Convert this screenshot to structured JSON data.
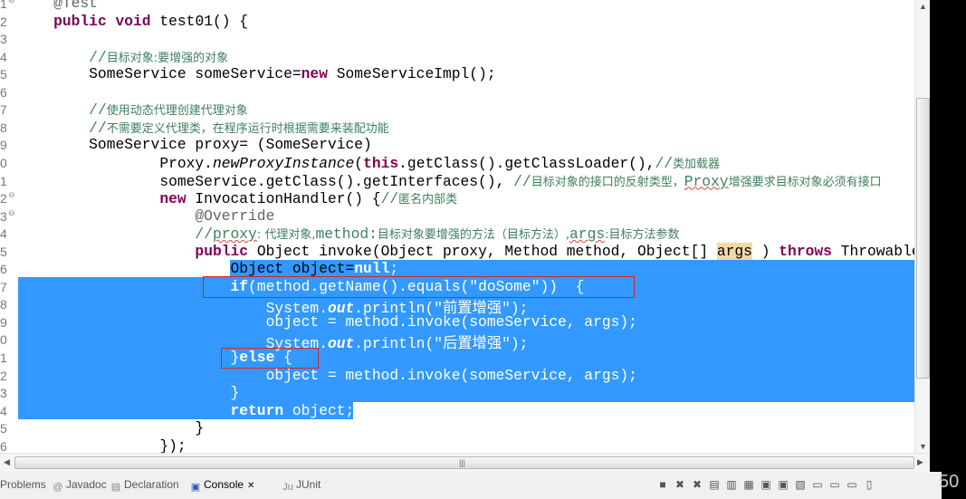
{
  "editor": {
    "lines": [
      {
        "num": "1",
        "fold": true,
        "segs": [
          [
            "an",
            "    @Test"
          ]
        ]
      },
      {
        "num": "2",
        "segs": [
          [
            "",
            "    "
          ],
          [
            "kw",
            "public"
          ],
          [
            "",
            " "
          ],
          [
            "kw",
            "void"
          ],
          [
            "",
            " test01() {"
          ]
        ]
      },
      {
        "num": "3",
        "segs": []
      },
      {
        "num": "4",
        "segs": [
          [
            "",
            "        "
          ],
          [
            "cm",
            "//"
          ],
          [
            "cmz",
            "目标对象:要增强的对象"
          ]
        ]
      },
      {
        "num": "5",
        "segs": [
          [
            "",
            "        SomeService someService="
          ],
          [
            "kw",
            "new"
          ],
          [
            "",
            " SomeServiceImpl();"
          ]
        ]
      },
      {
        "num": "6",
        "segs": []
      },
      {
        "num": "7",
        "segs": [
          [
            "",
            "        "
          ],
          [
            "cm",
            "//"
          ],
          [
            "cmz",
            "使用动态代理创建代理对象"
          ]
        ]
      },
      {
        "num": "8",
        "segs": [
          [
            "",
            "        "
          ],
          [
            "cm",
            "//"
          ],
          [
            "cmz",
            "不需要定义代理类，在程序运行时根据需要来装配功能"
          ]
        ]
      },
      {
        "num": "9",
        "segs": [
          [
            "",
            "        SomeService proxy= (SomeService)"
          ]
        ]
      },
      {
        "num": "0",
        "segs": [
          [
            "",
            "                Proxy."
          ],
          [
            "it",
            "newProxyInstance"
          ],
          [
            "",
            "("
          ],
          [
            "kw",
            "this"
          ],
          [
            "",
            ".getClass().getClassLoader(),"
          ],
          [
            "cm",
            "//"
          ],
          [
            "cmz",
            "类加载器"
          ]
        ]
      },
      {
        "num": "1",
        "segs": [
          [
            "",
            "                someService.getClass().getInterfaces(), "
          ],
          [
            "cm",
            "//"
          ],
          [
            "cmz",
            "目标对象的接口的反射类型，"
          ],
          [
            "cm sq",
            "Proxy"
          ],
          [
            "cmz",
            "增强要求目标对象必须有接口"
          ]
        ]
      },
      {
        "num": "2",
        "fold": true,
        "segs": [
          [
            "",
            "                "
          ],
          [
            "kw",
            "new"
          ],
          [
            "",
            " InvocationHandler() {"
          ],
          [
            "cm",
            "//"
          ],
          [
            "cmz",
            "匿名内部类"
          ]
        ]
      },
      {
        "num": "3",
        "fold": true,
        "segs": [
          [
            "an",
            "                    @Override"
          ]
        ]
      },
      {
        "num": "4",
        "segs": [
          [
            "",
            "                    "
          ],
          [
            "cm",
            "//"
          ],
          [
            "cm sq",
            "proxy"
          ],
          [
            "cmz",
            ": 代理对象,"
          ],
          [
            "cm",
            "method:"
          ],
          [
            "cmz",
            "目标对象要增强的方法（目标方法）,"
          ],
          [
            "cm sq",
            "args"
          ],
          [
            "cmz",
            ":目标方法参数"
          ]
        ]
      },
      {
        "num": "5",
        "segs": [
          [
            "",
            "                    "
          ],
          [
            "kw",
            "public"
          ],
          [
            "",
            " Object invoke(Object proxy, Method method, Object[] "
          ],
          [
            "occ",
            "args"
          ],
          [
            "",
            " ) "
          ],
          [
            "kw",
            "throws"
          ],
          [
            "",
            " Throwable {"
          ]
        ]
      },
      {
        "num": "6",
        "segs": [
          [
            "",
            "                        Object object="
          ],
          [
            "kw",
            "null"
          ],
          [
            "",
            ";"
          ]
        ]
      },
      {
        "num": "7",
        "segs": [
          [
            "",
            "                        "
          ],
          [
            "kw",
            "if"
          ],
          [
            "",
            "(method.getName().equals("
          ],
          [
            "st",
            "\"doSome\""
          ],
          [
            "",
            "))  {"
          ]
        ]
      },
      {
        "num": "8",
        "segs": [
          [
            "",
            "                            System."
          ],
          [
            "fd",
            "out"
          ],
          [
            "",
            ".println("
          ],
          [
            "st",
            "\"前置增强\""
          ],
          [
            "",
            ");"
          ]
        ]
      },
      {
        "num": "9",
        "segs": [
          [
            "",
            "                            object = method.invoke(someService, args);"
          ]
        ]
      },
      {
        "num": "0",
        "segs": [
          [
            "",
            "                            System."
          ],
          [
            "fd",
            "out"
          ],
          [
            "",
            ".println("
          ],
          [
            "st",
            "\"后置增强\""
          ],
          [
            "",
            ");"
          ]
        ]
      },
      {
        "num": "1",
        "segs": [
          [
            "",
            "                        }"
          ],
          [
            "kw",
            "else"
          ],
          [
            "",
            " {"
          ]
        ]
      },
      {
        "num": "2",
        "segs": [
          [
            "",
            "                            object = method.invoke(someService, args);"
          ]
        ]
      },
      {
        "num": "3",
        "segs": [
          [
            "",
            "                        }"
          ]
        ]
      },
      {
        "num": "4",
        "segs": [
          [
            "",
            "                        "
          ],
          [
            "kw",
            "return"
          ],
          [
            "",
            " object;"
          ]
        ]
      },
      {
        "num": "5",
        "segs": [
          [
            "",
            "                    }"
          ]
        ]
      },
      {
        "num": "6",
        "segs": [
          [
            "",
            "                });"
          ]
        ]
      }
    ]
  },
  "panel": {
    "tabs": [
      {
        "label": "Problems",
        "icon": "problems-icon"
      },
      {
        "label": "Javadoc",
        "icon": "javadoc-icon",
        "glyph": "@"
      },
      {
        "label": "Declaration",
        "icon": "declaration-icon",
        "glyph": "▤"
      },
      {
        "label": "Console",
        "icon": "console-icon",
        "glyph": "▣",
        "active": true,
        "close": "✕"
      },
      {
        "label": "JUnit",
        "icon": "junit-icon",
        "glyph": "Ju"
      }
    ],
    "toolbar_icons": [
      "terminate-icon",
      "remove-launch-icon",
      "remove-all-icon",
      "clear-console-icon",
      "scroll-lock-icon",
      "word-wrap-icon",
      "show-on-output-icon",
      "show-on-error-icon",
      "pin-console-icon",
      "display-console-icon",
      "open-console-icon",
      "minimize-icon",
      "maximize-icon"
    ]
  },
  "watermark": "50",
  "colors": {
    "selection": "#3399ff",
    "keyword": "#7f0055",
    "comment": "#3f7f5f",
    "string": "#2a00ff",
    "annotation_box": "#e02020"
  }
}
